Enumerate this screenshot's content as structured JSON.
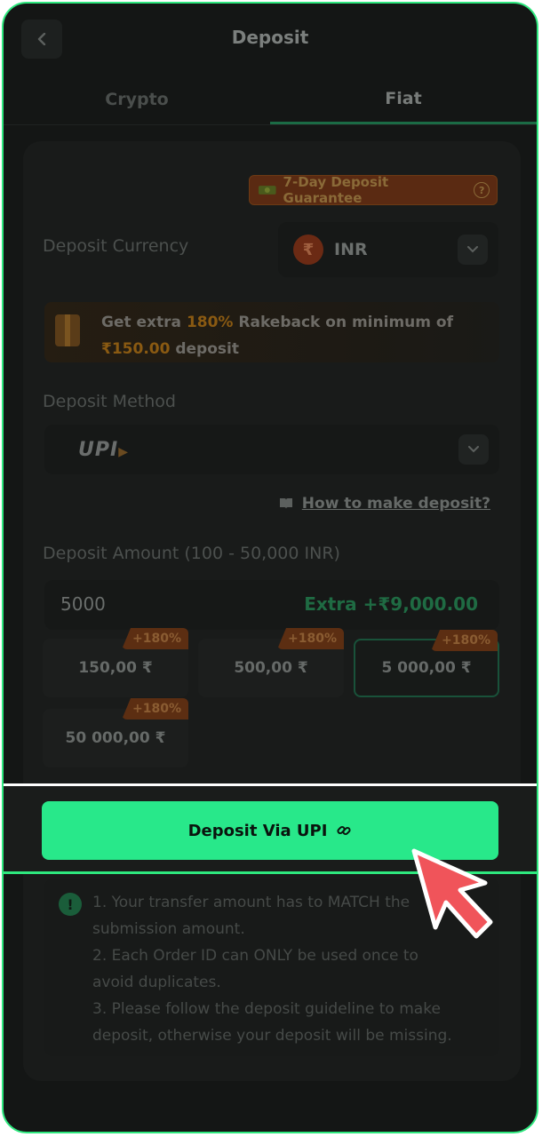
{
  "header": {
    "title": "Deposit"
  },
  "tabs": [
    {
      "label": "Crypto"
    },
    {
      "label": "Fiat"
    }
  ],
  "guarantee": {
    "label": "7-Day Deposit Guarantee"
  },
  "currency": {
    "label": "Deposit Currency",
    "value": "INR",
    "symbol": "₹"
  },
  "promo": {
    "prefix": "Get extra ",
    "percent": "180%",
    "middle": " Rakeback on minimum of",
    "min_amount": "₹150.00",
    "suffix": " deposit"
  },
  "method": {
    "label": "Deposit Method",
    "selected_logo": "UPI"
  },
  "howto": {
    "label": "How to make deposit?"
  },
  "amount": {
    "label": "Deposit Amount (100 - 50,000 INR)",
    "value": "5000",
    "extra": "Extra +₹9,000.00"
  },
  "chips": [
    {
      "amount": "150,00 ₹",
      "badge": "+180%",
      "selected": false
    },
    {
      "amount": "500,00 ₹",
      "badge": "+180%",
      "selected": false
    },
    {
      "amount": "5 000,00 ₹",
      "badge": "+180%",
      "selected": true
    },
    {
      "amount": "50 000,00 ₹",
      "badge": "+180%",
      "selected": false
    }
  ],
  "cta": {
    "label": "Deposit Via UPI"
  },
  "notice": {
    "icon": "!",
    "lines": [
      "1. Your transfer amount has to MATCH the",
      "submission amount.",
      "2. Each Order ID can ONLY be used once to",
      "avoid duplicates.",
      "3. Please follow the deposit guideline to make",
      "deposit, otherwise your deposit will be missing."
    ]
  },
  "colors": {
    "accent": "#28e88a",
    "frame": "#2ee87e",
    "cursor": "#f0545a"
  }
}
